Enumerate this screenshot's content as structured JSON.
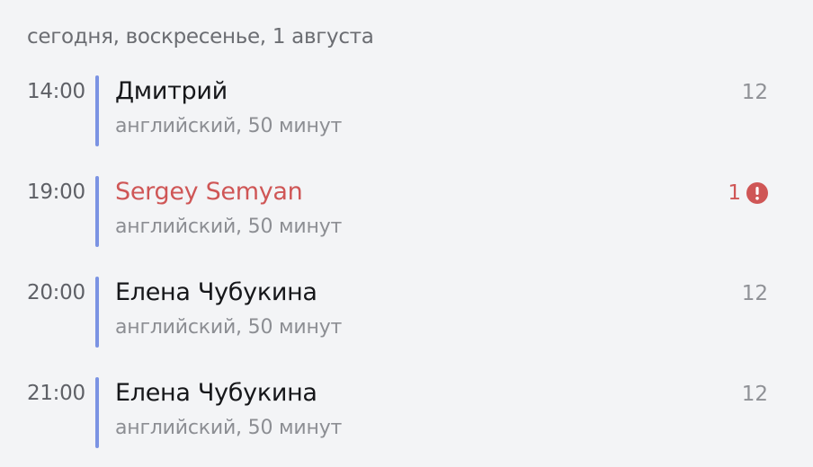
{
  "day_header": "сегодня, воскресенье, 1 августа",
  "lessons": [
    {
      "time": "14:00",
      "student": "Дмитрий",
      "details": "английский, 50 минут",
      "count": "12",
      "alert": false
    },
    {
      "time": "19:00",
      "student": "Sergey Semyan",
      "details": "английский, 50 минут",
      "count": "1",
      "alert": true,
      "icon": "exclamation-circle-icon"
    },
    {
      "time": "20:00",
      "student": "Елена Чубукина",
      "details": "английский, 50 минут",
      "count": "12",
      "alert": false
    },
    {
      "time": "21:00",
      "student": "Елена Чубукина",
      "details": "английский, 50 минут",
      "count": "12",
      "alert": false
    }
  ],
  "colors": {
    "accent_bar": "#7b93e3",
    "warning": "#cf5656",
    "background": "#f3f4f6"
  }
}
